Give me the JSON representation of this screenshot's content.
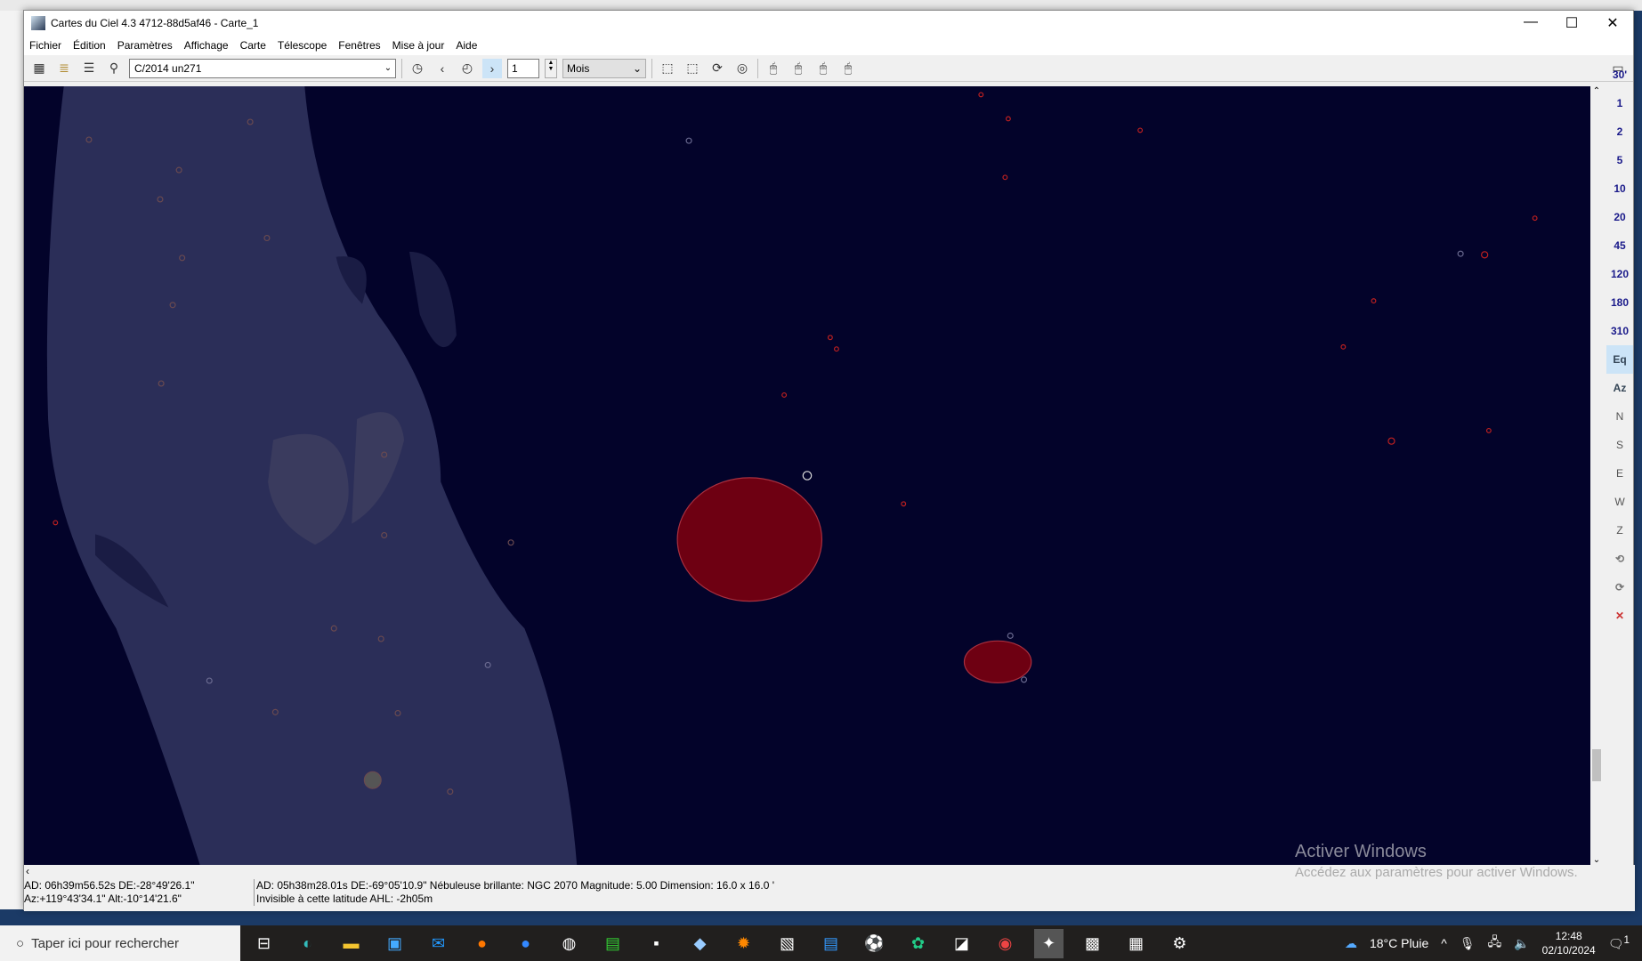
{
  "window": {
    "title": "Cartes du Ciel 4.3 4712-88d5af46 - Carte_1",
    "min": "—",
    "max": "☐",
    "close": "✕"
  },
  "menu": [
    "Fichier",
    "Édition",
    "Paramètres",
    "Affichage",
    "Carte",
    "Télescope",
    "Fenêtres",
    "Mise à jour",
    "Aide"
  ],
  "toolbar": {
    "search_value": "C/2014 un271",
    "step_value": "1",
    "step_unit": "Mois"
  },
  "zoom_levels": [
    "30'",
    "1",
    "2",
    "5",
    "10",
    "20",
    "45",
    "120",
    "180",
    "310"
  ],
  "projection_buttons": [
    "Eq",
    "Az"
  ],
  "orientation_buttons": [
    "N",
    "S",
    "E",
    "W",
    "Z"
  ],
  "status": {
    "cursor_line1": "AD: 06h39m56.52s DE:-28°49'26.1\"",
    "cursor_line2": "Az:+119°43'34.1\" Alt:-10°14'21.6\"",
    "object_line1": "AD: 05h38m28.01s DE:-69°05'10.9\"  Nébuleuse brillante: NGC 2070   Magnitude:  5.00  Dimension:  16.0 x 16.0 '",
    "object_line2": "Invisible à cette latitude  AHL:  -2h05m"
  },
  "watermark": {
    "title": "Activer Windows",
    "subtitle": "Accédez aux paramètres pour activer Windows."
  },
  "taskbar": {
    "search_placeholder": "Taper ici pour rechercher",
    "weather": "18°C  Pluie",
    "time": "12:48",
    "date": "02/10/2024",
    "notif_count": "1"
  },
  "colors": {
    "sky": "#03032a",
    "milkyway": "#2b2e58",
    "nebula": "#6e0012"
  }
}
